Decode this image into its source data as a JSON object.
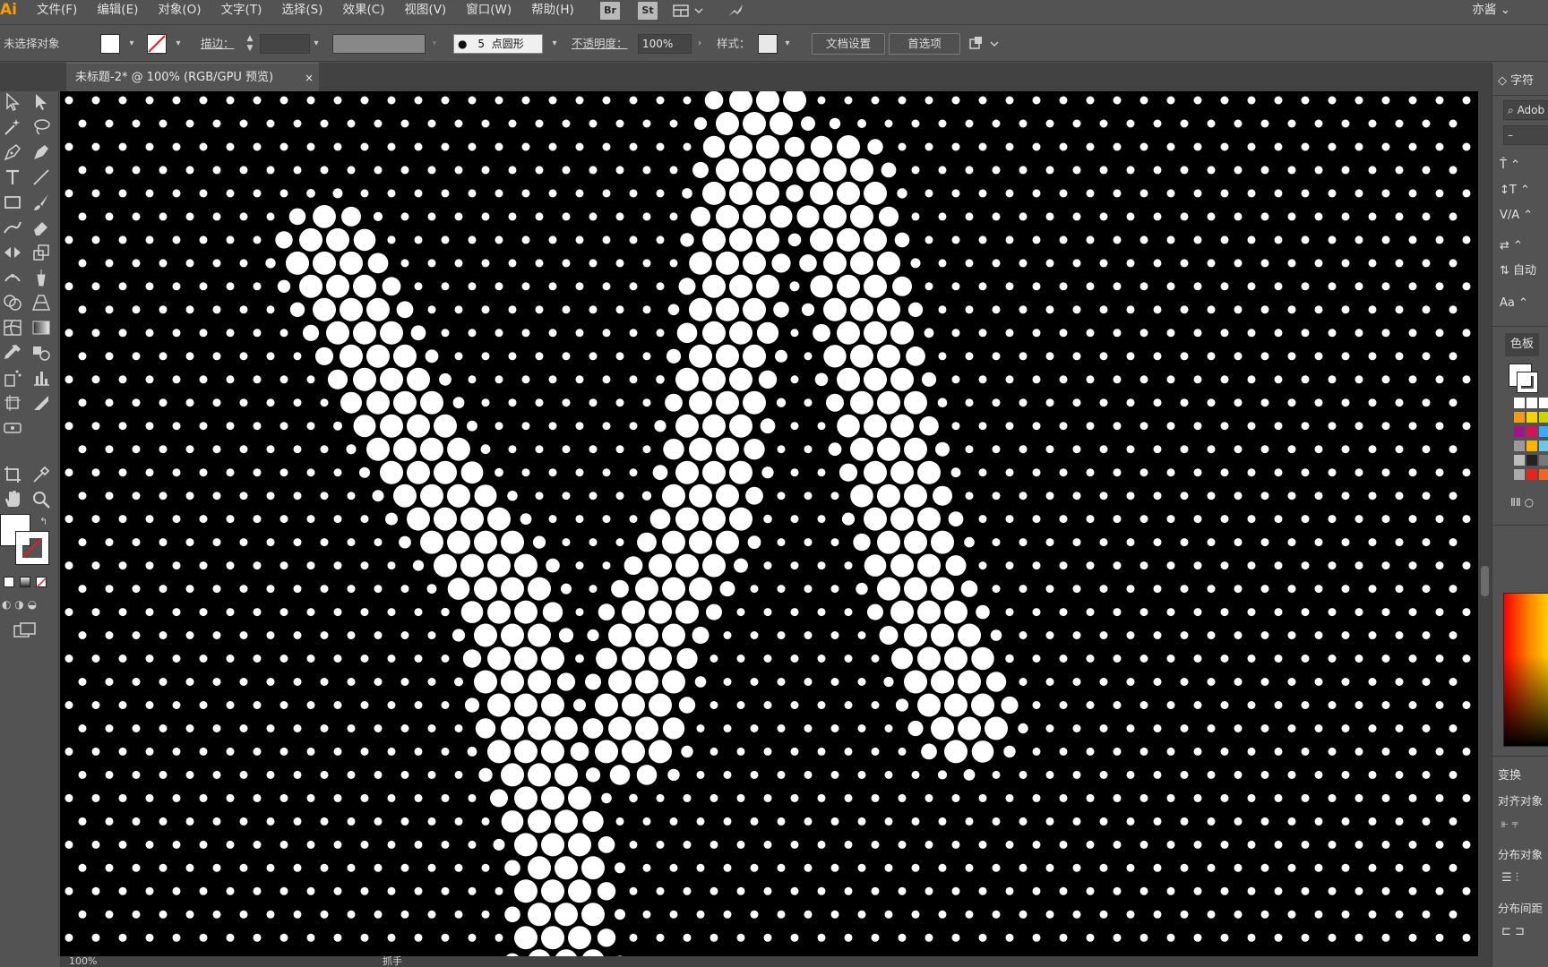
{
  "app": {
    "logo": "Ai"
  },
  "menu": {
    "items": [
      "文件(F)",
      "编辑(E)",
      "对象(O)",
      "文字(T)",
      "选择(S)",
      "效果(C)",
      "视图(V)",
      "窗口(W)",
      "帮助(H)"
    ],
    "bridge_label": "Br",
    "stock_label": "St",
    "workspace": "亦酱"
  },
  "control_bar": {
    "selection_status": "未选择对象",
    "stroke_label": "描边：",
    "brush_size": "5",
    "brush_shape": "点圆形",
    "opacity_label": "不透明度：",
    "opacity_value": "100%",
    "style_label": "样式：",
    "doc_setup_button": "文档设置",
    "preferences_button": "首选项"
  },
  "document_tab": {
    "title": "未标题-2* @ 100% (RGB/GPU 预览)",
    "close": "×"
  },
  "status_bar": {
    "zoom": "100%",
    "tool": "抓手"
  },
  "right_panel": {
    "character_tab": "字符",
    "font_search_value": "Adob",
    "font_style_value": "–",
    "swatches_tab": "色板",
    "transform_tab": "变换",
    "align_objects_label": "对齐对象",
    "distribute_objects_label": "分布对象",
    "distribute_spacing_label": "分布间距",
    "auto_label": "自动"
  },
  "colors": {
    "ui_background": "#535353",
    "ui_dark": "#424242",
    "canvas": "#000000",
    "dot": "#ffffff",
    "accent_logo": "#ff9a00"
  },
  "icons": {
    "tools": [
      "selection-icon",
      "direct-selection-icon",
      "magic-wand-icon",
      "lasso-icon",
      "pen-icon",
      "curvature-icon",
      "type-icon",
      "line-icon",
      "rectangle-icon",
      "paintbrush-icon",
      "shaper-icon",
      "eraser-icon",
      "rotate-icon",
      "scale-icon",
      "width-icon",
      "puppet-warp-icon",
      "shape-builder-icon",
      "perspective-icon",
      "mesh-icon",
      "gradient-icon",
      "eyedropper-icon",
      "blend-icon",
      "symbol-sprayer-icon",
      "column-graph-icon",
      "artboard-icon",
      "slice-icon",
      "hand-icon",
      "zoom-icon"
    ]
  }
}
